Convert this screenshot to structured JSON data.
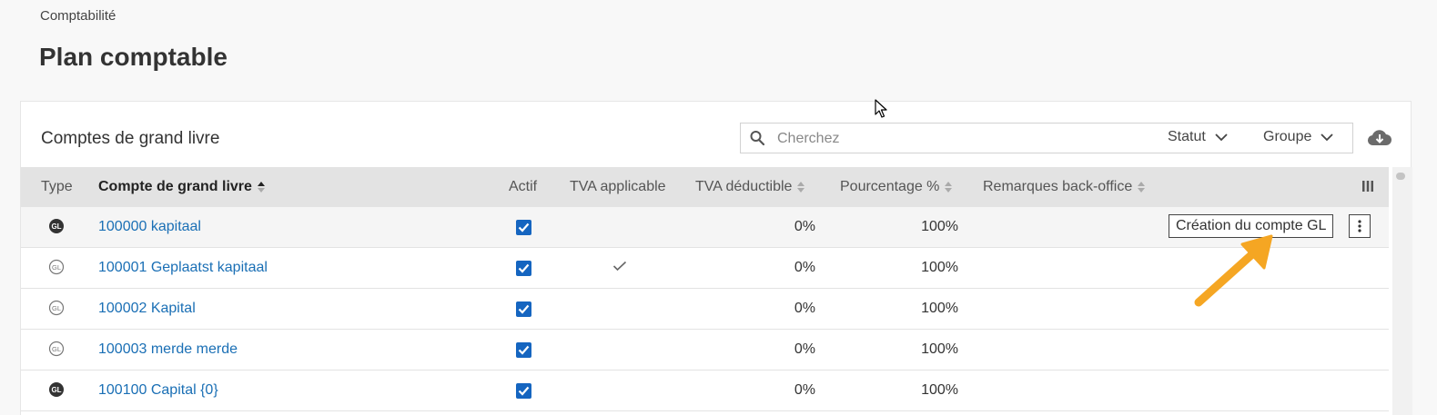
{
  "breadcrumb": "Comptabilité",
  "page_title": "Plan comptable",
  "card": {
    "title": "Comptes de grand livre",
    "search_placeholder": "Cherchez",
    "filters": {
      "status_label": "Statut",
      "group_label": "Groupe"
    },
    "download_icon": "cloud-download-icon"
  },
  "table": {
    "columns": {
      "type": "Type",
      "account": "Compte de grand livre",
      "active": "Actif",
      "vat_applicable": "TVA applicable",
      "vat_deductible": "TVA déductible",
      "percentage": "Pourcentage %",
      "remarks": "Remarques back-office"
    },
    "rows": [
      {
        "account": "100000 kapitaal",
        "type_icon": "gl-filled-icon",
        "active": true,
        "vat_applicable": false,
        "vat_deductible": "0%",
        "percentage": "100%"
      },
      {
        "account": "100001 Geplaatst kapitaal",
        "type_icon": "gl-outline-icon",
        "active": true,
        "vat_applicable": true,
        "vat_deductible": "0%",
        "percentage": "100%"
      },
      {
        "account": "100002 Kapital",
        "type_icon": "gl-outline-icon",
        "active": true,
        "vat_applicable": false,
        "vat_deductible": "0%",
        "percentage": "100%"
      },
      {
        "account": "100003 merde merde",
        "type_icon": "gl-outline-icon",
        "active": true,
        "vat_applicable": false,
        "vat_deductible": "0%",
        "percentage": "100%"
      },
      {
        "account": "100100 Capital {0}",
        "type_icon": "gl-filled-icon",
        "active": true,
        "vat_applicable": false,
        "vat_deductible": "0%",
        "percentage": "100%"
      }
    ],
    "row_action": "Création du compte GL"
  },
  "colors": {
    "link": "#1a6fb5",
    "checkbox": "#1565c0",
    "header_bg": "#e3e3e3",
    "annotation_arrow": "#f5a623"
  }
}
